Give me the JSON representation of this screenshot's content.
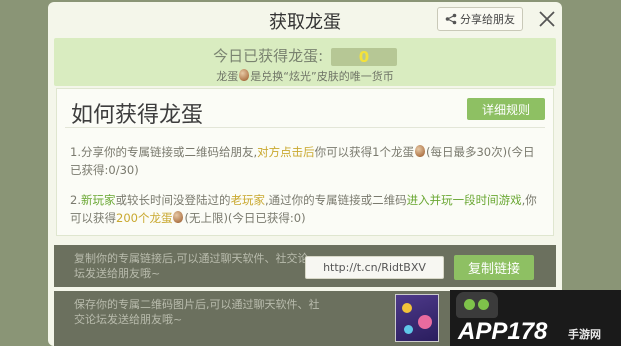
{
  "dialog": {
    "title": "获取龙蛋",
    "share_label": "分享给朋友"
  },
  "egg_header": {
    "count_label": "今日已获得龙蛋:",
    "count_value": "0",
    "note_prefix": "龙蛋",
    "note_suffix": "是兑换“炫光”皮肤的唯一货币"
  },
  "howto": {
    "title": "如何获得龙蛋",
    "rules_label": "详细规则",
    "p1_a": "1.分享你的专属链接或二维码给朋友,",
    "p1_hl": "对方点击后",
    "p1_b": "你可以获得1个龙蛋",
    "p1_c": "(每日最多30次)(今日已获得:0/30)",
    "p2_a": "2.",
    "p2_hl1": "新玩家",
    "p2_b": "或较长时间没登陆过的",
    "p2_hl2": "老玩家",
    "p2_c": ",通过你的专属链接或二维码",
    "p2_hl3": "进入并玩一段时间游戏",
    "p2_d": ",你可以获得",
    "p2_hl4": "200个龙蛋",
    "p2_e": "(无上限)(今日已获得:0)"
  },
  "link_row": {
    "hint": "复制你的专属链接后,可以通过聊天软件、社交论坛发送给朋友哦~",
    "url": "http://t.cn/RidtBXV",
    "copy_label": "复制链接"
  },
  "qr_row": {
    "hint": "保存你的专属二维码图片后,可以通过聊天软件、社交论坛发送给朋友哦~"
  },
  "watermark": {
    "brand": "APP178",
    "sub": "手游网"
  },
  "colors": {
    "accent_green": "#8ec063",
    "highlight_green": "#6aa733",
    "highlight_yellow": "#c9a82f"
  }
}
